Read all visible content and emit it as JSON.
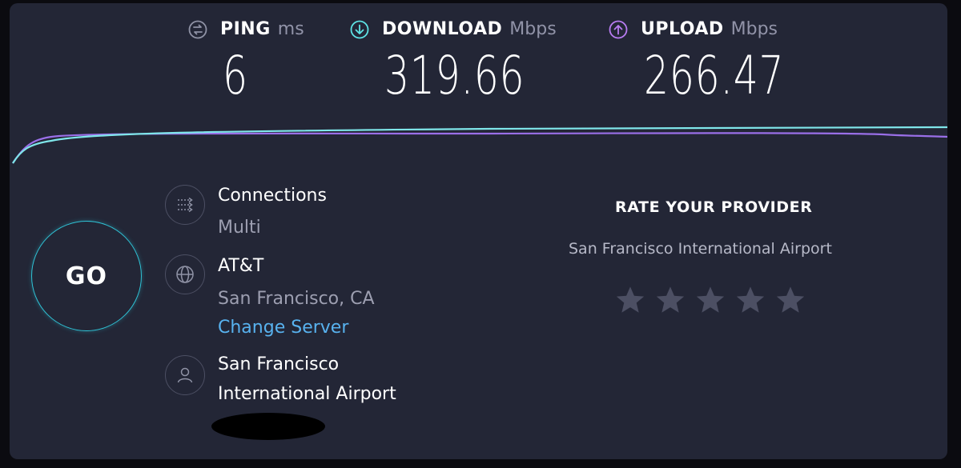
{
  "metrics": {
    "ping": {
      "label": "PING",
      "unit": "ms",
      "value": "6",
      "icon": "ping-icon",
      "color": "#8f92a5"
    },
    "download": {
      "label": "DOWNLOAD",
      "unit": "Mbps",
      "value": "319.66",
      "icon": "download-icon",
      "color": "#5ee3e5"
    },
    "upload": {
      "label": "UPLOAD",
      "unit": "Mbps",
      "value": "266.47",
      "icon": "upload-icon",
      "color": "#b87cf2"
    }
  },
  "go_button": {
    "label": "GO",
    "color": "#2fc3d6"
  },
  "connections": {
    "label": "Connections",
    "value": "Multi",
    "icon": "connections-icon"
  },
  "server": {
    "provider": "AT&T",
    "location": "San Francisco, CA",
    "change_label": "Change Server",
    "icon": "globe-icon"
  },
  "user": {
    "line1": "San Francisco",
    "line2": "International Airport",
    "icon": "user-icon"
  },
  "rating": {
    "title": "RATE YOUR PROVIDER",
    "provider": "San Francisco International Airport",
    "star_count": 5,
    "stars_filled": 0
  },
  "colors": {
    "background": "#232636",
    "accent_download": "#5ee3e5",
    "accent_upload": "#b87cf2",
    "link": "#58b2ef"
  }
}
